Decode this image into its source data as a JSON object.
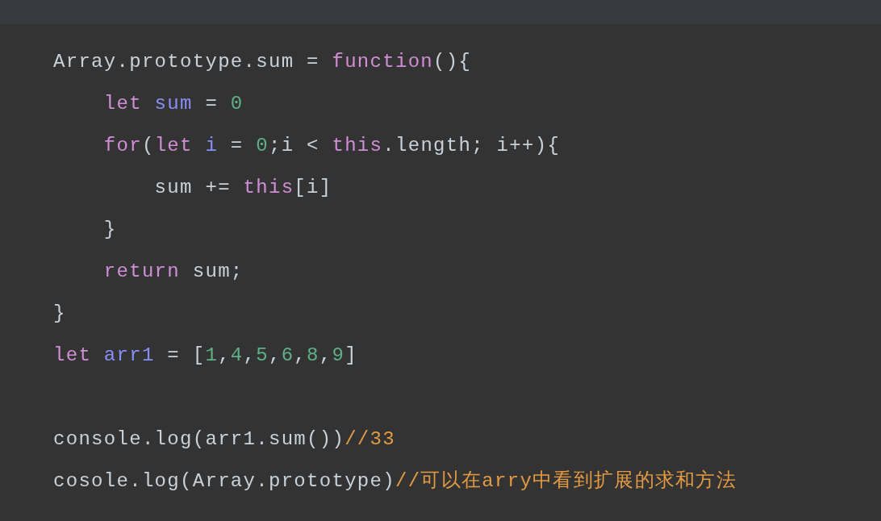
{
  "code_lines": [
    {
      "kind": "code",
      "tokens": [
        {
          "kind": "plain",
          "text": "Array.prototype.sum = "
        },
        {
          "kind": "keyword",
          "text": "function"
        },
        {
          "kind": "plain",
          "text": "(){"
        }
      ]
    },
    {
      "kind": "code",
      "tokens": [
        {
          "kind": "keyword",
          "text": "    let"
        },
        {
          "kind": "variable",
          "text": " sum"
        },
        {
          "kind": "plain",
          "text": " = "
        },
        {
          "kind": "number",
          "text": "0"
        }
      ]
    },
    {
      "kind": "code",
      "tokens": [
        {
          "kind": "keyword",
          "text": "    for"
        },
        {
          "kind": "plain",
          "text": "("
        },
        {
          "kind": "keyword",
          "text": "let"
        },
        {
          "kind": "variable",
          "text": " i"
        },
        {
          "kind": "plain",
          "text": " = "
        },
        {
          "kind": "number",
          "text": "0"
        },
        {
          "kind": "plain",
          "text": ";i < "
        },
        {
          "kind": "keyword",
          "text": "this"
        },
        {
          "kind": "plain",
          "text": ".length; i++){"
        }
      ]
    },
    {
      "kind": "code",
      "tokens": [
        {
          "kind": "plain",
          "text": "        sum += "
        },
        {
          "kind": "keyword",
          "text": "this"
        },
        {
          "kind": "plain",
          "text": "[i]"
        }
      ]
    },
    {
      "kind": "code",
      "tokens": [
        {
          "kind": "plain",
          "text": "    }"
        }
      ]
    },
    {
      "kind": "code",
      "tokens": [
        {
          "kind": "keyword",
          "text": "    return"
        },
        {
          "kind": "plain",
          "text": " sum;"
        }
      ]
    },
    {
      "kind": "code",
      "tokens": [
        {
          "kind": "plain",
          "text": "}"
        }
      ]
    },
    {
      "kind": "code",
      "tokens": [
        {
          "kind": "keyword",
          "text": "let"
        },
        {
          "kind": "variable",
          "text": " arr1"
        },
        {
          "kind": "plain",
          "text": " = ["
        },
        {
          "kind": "number",
          "text": "1"
        },
        {
          "kind": "plain",
          "text": ","
        },
        {
          "kind": "number",
          "text": "4"
        },
        {
          "kind": "plain",
          "text": ","
        },
        {
          "kind": "number",
          "text": "5"
        },
        {
          "kind": "plain",
          "text": ","
        },
        {
          "kind": "number",
          "text": "6"
        },
        {
          "kind": "plain",
          "text": ","
        },
        {
          "kind": "number",
          "text": "8"
        },
        {
          "kind": "plain",
          "text": ","
        },
        {
          "kind": "number",
          "text": "9"
        },
        {
          "kind": "plain",
          "text": "]"
        }
      ]
    },
    {
      "kind": "blank"
    },
    {
      "kind": "code",
      "tokens": [
        {
          "kind": "plain",
          "text": "console.log(arr1.sum())"
        },
        {
          "kind": "comment",
          "text": "//33"
        }
      ]
    },
    {
      "kind": "code",
      "tokens": [
        {
          "kind": "plain",
          "text": "cosole.log(Array.prototype)"
        },
        {
          "kind": "comment",
          "text": "//可以在arry中看到扩展的求和方法"
        }
      ]
    }
  ]
}
